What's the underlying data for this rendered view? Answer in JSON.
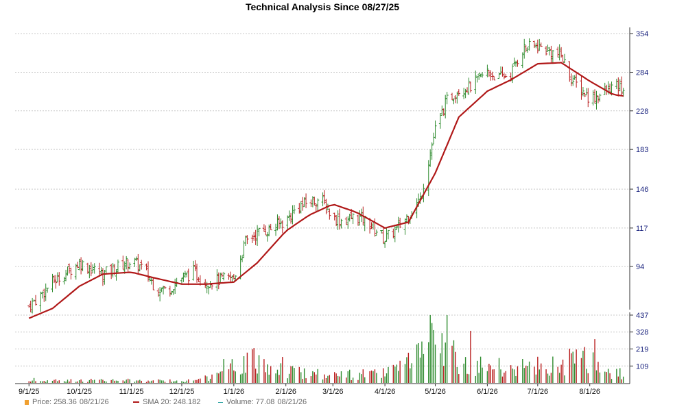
{
  "title": "Technical Analysis Since 08/27/25",
  "colors": {
    "up": "#2e8b2e",
    "down": "#b81c1c",
    "sma": "#b01818",
    "grid": "#c8c8c8",
    "axis_text_price": "#1a237e",
    "axis_text_volume": "#1a237e",
    "legend_text": "#6a6a6a"
  },
  "legend": {
    "price_label": "Price: 258.36",
    "price_date": "08/21/26",
    "sma_label": "SMA 20: 248.182",
    "volume_label": "Volume: 77.08",
    "volume_date": "08/21/26"
  },
  "chart_data": {
    "type": "line",
    "title": "Technical Analysis Since 08/27/25",
    "price_ticks": [
      "354",
      "284",
      "228",
      "183",
      "146",
      "117",
      "94"
    ],
    "price_tick_values": [
      354,
      284,
      228,
      183,
      146,
      117,
      94
    ],
    "price_scale": "log",
    "volume_ticks": [
      "437",
      "328",
      "219",
      "109"
    ],
    "volume_tick_values": [
      437,
      328,
      219,
      109
    ],
    "x_tick_labels": [
      "9/1/25",
      "10/1/25",
      "11/1/25",
      "12/1/25",
      "1/1/26",
      "2/1/26",
      "3/1/26",
      "4/1/26",
      "5/1/26",
      "6/1/26",
      "7/1/26",
      "8/1/26"
    ],
    "grid": true,
    "series": [
      {
        "name": "Price",
        "kind": "ohlc_close",
        "points": [
          [
            "2025-09-01",
            75
          ],
          [
            "2025-09-08",
            80
          ],
          [
            "2025-09-15",
            86
          ],
          [
            "2025-09-22",
            90
          ],
          [
            "2025-10-01",
            96
          ],
          [
            "2025-10-08",
            93
          ],
          [
            "2025-10-15",
            90
          ],
          [
            "2025-10-22",
            93
          ],
          [
            "2025-11-01",
            97
          ],
          [
            "2025-11-08",
            93
          ],
          [
            "2025-11-15",
            84
          ],
          [
            "2025-11-22",
            82
          ],
          [
            "2025-12-01",
            88
          ],
          [
            "2025-12-08",
            91
          ],
          [
            "2025-12-15",
            86
          ],
          [
            "2025-12-22",
            87
          ],
          [
            "2026-01-01",
            88
          ],
          [
            "2026-01-08",
            108
          ],
          [
            "2026-01-15",
            114
          ],
          [
            "2026-01-22",
            116
          ],
          [
            "2026-02-01",
            122
          ],
          [
            "2026-02-08",
            132
          ],
          [
            "2026-02-15",
            136
          ],
          [
            "2026-02-22",
            138
          ],
          [
            "2026-03-01",
            124
          ],
          [
            "2026-03-08",
            122
          ],
          [
            "2026-03-15",
            125
          ],
          [
            "2026-03-22",
            121
          ],
          [
            "2026-04-01",
            110
          ],
          [
            "2026-04-08",
            116
          ],
          [
            "2026-04-15",
            126
          ],
          [
            "2026-04-22",
            138
          ],
          [
            "2026-05-01",
            205
          ],
          [
            "2026-05-08",
            242
          ],
          [
            "2026-05-15",
            258
          ],
          [
            "2026-05-22",
            262
          ],
          [
            "2026-06-01",
            285
          ],
          [
            "2026-06-08",
            275
          ],
          [
            "2026-06-15",
            282
          ],
          [
            "2026-06-22",
            325
          ],
          [
            "2026-07-01",
            330
          ],
          [
            "2026-07-08",
            320
          ],
          [
            "2026-07-15",
            312
          ],
          [
            "2026-07-22",
            270
          ],
          [
            "2026-08-01",
            245
          ],
          [
            "2026-08-08",
            250
          ],
          [
            "2026-08-15",
            262
          ],
          [
            "2026-08-21",
            258.36
          ]
        ]
      },
      {
        "name": "SMA 20",
        "kind": "line",
        "points": [
          [
            "2025-09-01",
            70
          ],
          [
            "2025-09-15",
            74
          ],
          [
            "2025-10-01",
            84
          ],
          [
            "2025-10-15",
            90
          ],
          [
            "2025-11-01",
            91
          ],
          [
            "2025-11-15",
            88
          ],
          [
            "2025-12-01",
            85
          ],
          [
            "2025-12-15",
            85
          ],
          [
            "2026-01-01",
            86
          ],
          [
            "2026-01-15",
            96
          ],
          [
            "2026-02-01",
            115
          ],
          [
            "2026-02-15",
            126
          ],
          [
            "2026-03-01",
            134
          ],
          [
            "2026-03-15",
            128
          ],
          [
            "2026-04-01",
            117
          ],
          [
            "2026-04-15",
            121
          ],
          [
            "2026-05-01",
            160
          ],
          [
            "2026-05-15",
            220
          ],
          [
            "2026-06-01",
            255
          ],
          [
            "2026-06-15",
            272
          ],
          [
            "2026-07-01",
            298
          ],
          [
            "2026-07-15",
            300
          ],
          [
            "2026-08-01",
            270
          ],
          [
            "2026-08-15",
            250
          ],
          [
            "2026-08-21",
            248.182
          ]
        ]
      },
      {
        "name": "Volume",
        "kind": "bar",
        "points": [
          [
            "2025-09-01",
            20
          ],
          [
            "2025-10-01",
            30
          ],
          [
            "2025-11-01",
            25
          ],
          [
            "2025-12-01",
            22
          ],
          [
            "2026-01-08",
            260
          ],
          [
            "2026-02-01",
            140
          ],
          [
            "2026-03-01",
            80
          ],
          [
            "2026-04-01",
            100
          ],
          [
            "2026-05-01",
            437
          ],
          [
            "2026-06-01",
            160
          ],
          [
            "2026-07-01",
            170
          ],
          [
            "2026-08-01",
            270
          ],
          [
            "2026-08-21",
            77.08
          ]
        ]
      }
    ]
  }
}
